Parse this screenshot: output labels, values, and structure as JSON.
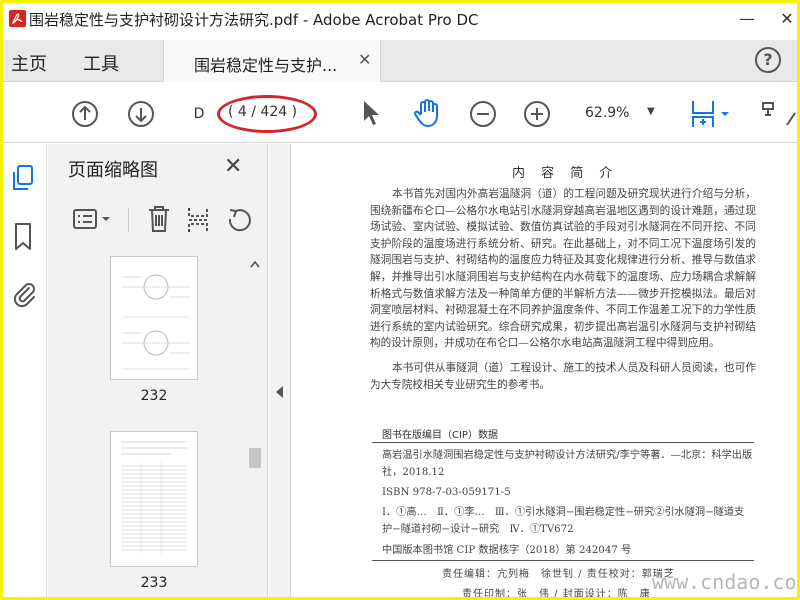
{
  "window": {
    "title": "围岩稳定性与支护衬砌设计方法研究.pdf - Adobe Acrobat Pro DC",
    "minimize_glyph": "—",
    "close_glyph": "✕"
  },
  "menu": {
    "home": "主页",
    "tools": "工具"
  },
  "doc_tab": {
    "label": "围岩稳定性与支护...",
    "close_glyph": "✕"
  },
  "help": {
    "glyph": "?"
  },
  "toolbar": {
    "page_input": "D",
    "page_count": "( 4 / 424 )",
    "zoom": "62.9%",
    "zoom_caret": "▼"
  },
  "icons": {
    "prev_page": "arrow-up-circle-icon",
    "next_page": "arrow-down-circle-icon",
    "select": "cursor-arrow-icon",
    "hand": "hand-tool-icon",
    "zoom_out": "zoom-out-icon",
    "zoom_in": "zoom-in-icon",
    "fit_page": "fit-page-icon"
  },
  "thumb_panel": {
    "title": "页面缩略图",
    "close_glyph": "✕",
    "thumbs": [
      {
        "label": "232"
      },
      {
        "label": "233"
      }
    ]
  },
  "document": {
    "heading": "内 容 简 介",
    "para1": "本书首先对国内外高岩温隧洞（道）的工程问题及研究现状进行介绍与分析，围绕新疆布仑口—公格尔水电站引水隧洞穿越高岩温地区遇到的设计难题，通过现场试验、室内试验、模拟试验、数值仿真试验的手段对引水隧洞在不同开挖、不同支护阶段的温度场进行系统分析、研究。在此基础上，对不同工况下温度场引发的隧洞围岩与支护、衬砌结构的温度应力特征及其变化规律进行分析、推导与数值求解，并推导出引水隧洞围岩与支护结构在内水荷载下的温度场、应力场耦合求解解析格式与数值求解方法及一种简单方便的半解析方法——微步开挖模拟法。最后对洞室喷层材料、衬砌混凝土在不同养护温度条件、不同工作温差工况下的力学性质进行系统的室内试验研究。综合研究成果，初步提出高岩温引水隧洞与支护衬砌结构的设计原则，并成功在布仑口—公格尔水电站高温隧洞工程中得到应用。",
    "para2": "本书可供从事隧洞（道）工程设计、施工的技术人员及科研人员阅读，也可作为大专院校相关专业研究生的参考书。",
    "cip_title": "图书在版编目（CIP）数据",
    "cip_line1": "高岩温引水隧洞围岩稳定性与支护衬砌设计方法研究/李宁等著．—北京：科学出版社，2018.12",
    "cip_line2": "ISBN 978-7-03-059171-5",
    "cip_line3": "Ⅰ．①高…　Ⅱ．①李…　Ⅲ．①引水隧洞−围岩稳定性−研究②引水隧洞−隧道支护−隧道衬砌−设计−研究　Ⅳ．①TV672",
    "cip_line4": "中国版本图书馆 CIP 数据核字（2018）第 242047 号",
    "editor_line1": "责任编辑：亢列梅　徐世钊 / 责任校对：郭瑞芝",
    "editor_line2": "责任印制：张　伟 / 封面设计：陈　康"
  },
  "watermark": "www.cndao.com",
  "colors": {
    "border_yellow": "#f4f400",
    "ellipse_red": "#d6262b",
    "accent_blue": "#1473e6",
    "icon_gray": "#555555"
  }
}
